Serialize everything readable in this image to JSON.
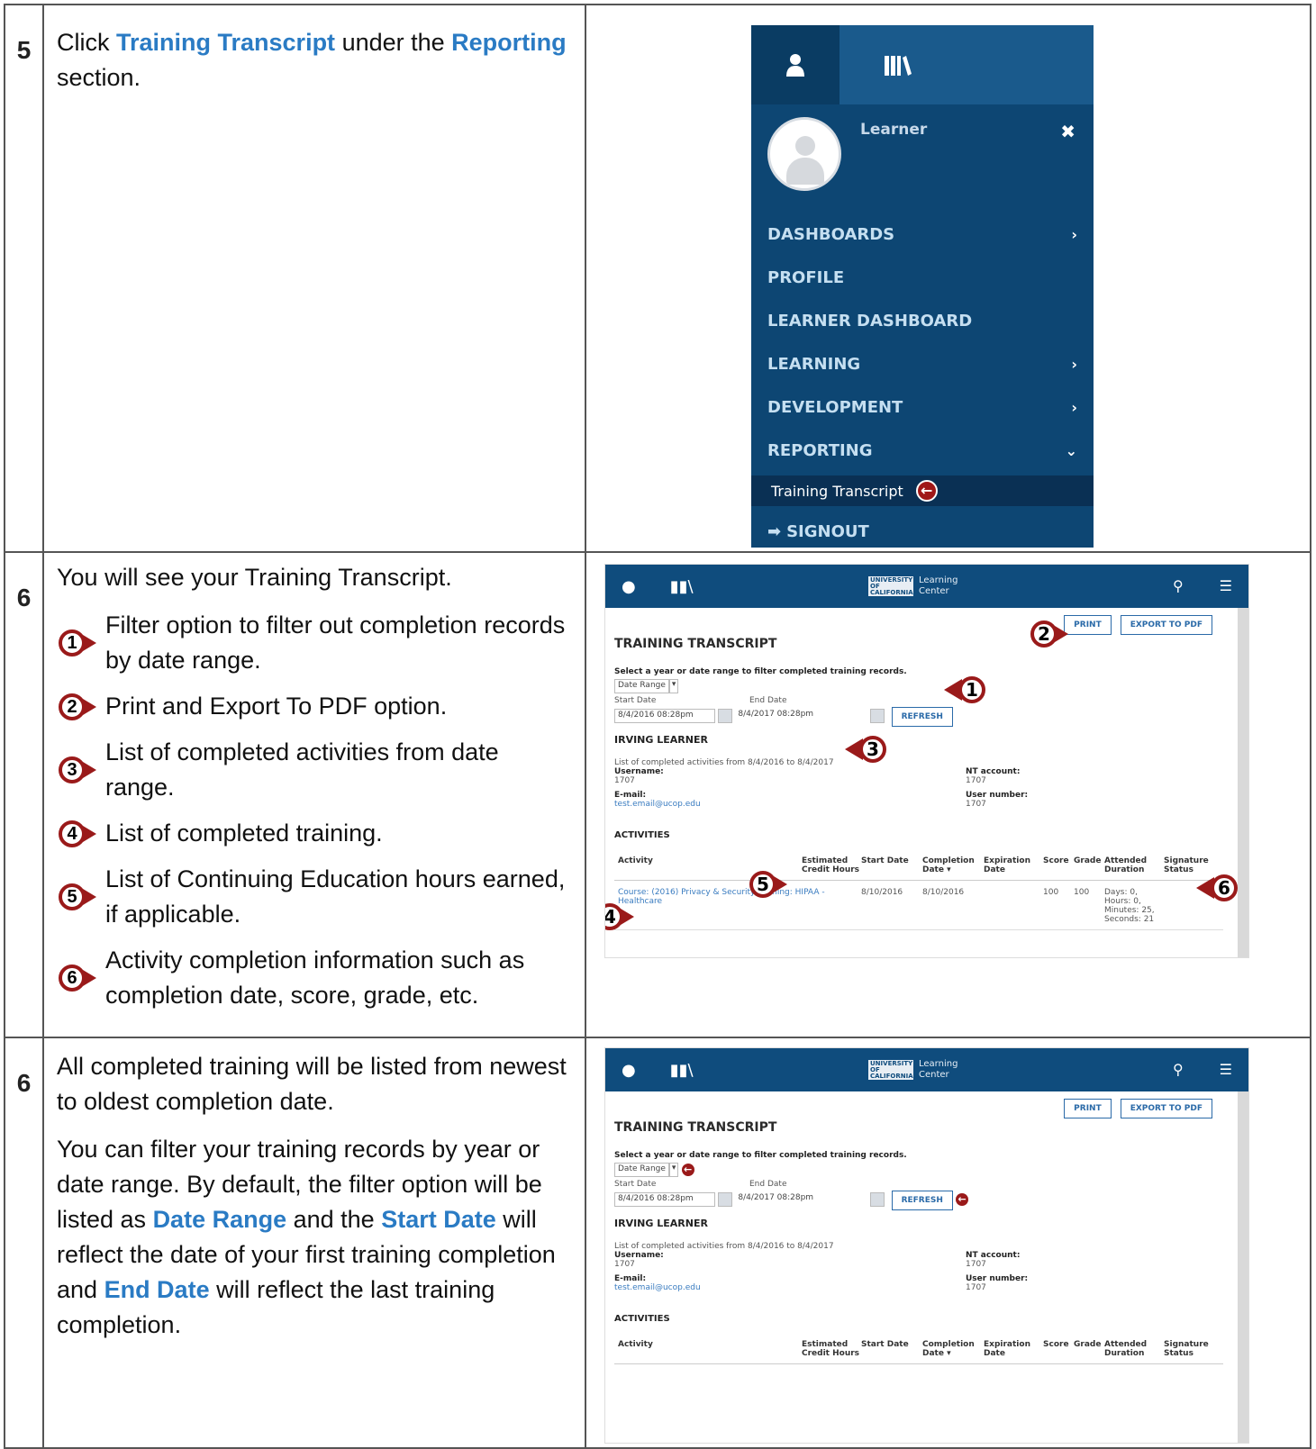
{
  "step5": {
    "number": "5",
    "text_pre": "Click ",
    "link1": "Training Transcript",
    "text_mid": " under the ",
    "link2": "Reporting",
    "text_post": " section.",
    "menu": {
      "learner_label": "Learner",
      "items": [
        {
          "label": "DASHBOARDS",
          "chevron": "›"
        },
        {
          "label": "PROFILE",
          "chevron": ""
        },
        {
          "label": "LEARNER DASHBOARD",
          "chevron": ""
        },
        {
          "label": "LEARNING",
          "chevron": "›"
        },
        {
          "label": "DEVELOPMENT",
          "chevron": "›"
        },
        {
          "label": "REPORTING",
          "chevron": "⌄"
        }
      ],
      "sub_item": "Training Transcript",
      "signout": "SIGNOUT"
    }
  },
  "step6a": {
    "number": "6",
    "intro": "You will see your Training Transcript.",
    "callouts": [
      {
        "n": "1",
        "text": "Filter option to filter out completion records by date range."
      },
      {
        "n": "2",
        "text": "Print and Export To PDF option."
      },
      {
        "n": "3",
        "text": "List of completed activities from date range."
      },
      {
        "n": "4",
        "text": "List of completed training."
      },
      {
        "n": "5",
        "text": "List of Continuing Education hours earned, if applicable."
      },
      {
        "n": "6",
        "text": "Activity completion information such as completion date, score, grade, etc."
      }
    ]
  },
  "step6b": {
    "number": "6",
    "p1": "All completed training will be listed from newest to oldest completion date.",
    "p2_a": "You can filter your training records by year or date range. By default, the filter option will be listed as ",
    "p2_b": "Date Range",
    "p2_c": " and the ",
    "p2_d": "Start Date",
    "p2_e": " will reflect the date of your first training completion and ",
    "p2_f": "End Date",
    "p2_g": " will reflect the last training completion."
  },
  "transcript": {
    "logo_uc": "UNIVERSITY OF CALIFORNIA",
    "logo_lc1": "Learning",
    "logo_lc2": "Center",
    "print": "PRINT",
    "export": "EXPORT TO PDF",
    "title": "TRAINING TRANSCRIPT",
    "filter_label": "Select a year or date range to filter completed training records.",
    "filter_value": "Date Range",
    "start_label": "Start Date",
    "end_label": "End Date",
    "start_value": "8/4/2016 08:28pm",
    "end_value": "8/4/2017 08:28pm",
    "refresh": "REFRESH",
    "name": "IRVING LEARNER",
    "range_text": "List of completed activities from  8/4/2016  to  8/4/2017",
    "username_label": "Username:",
    "username_value": "1707",
    "nt_label": "NT account:",
    "nt_value": "1707",
    "email_label": "E-mail:",
    "email_value": "test.email@ucop.edu",
    "usernum_label": "User number:",
    "usernum_value": "1707",
    "activities_title": "ACTIVITIES",
    "columns": [
      "Activity",
      "Estimated Credit Hours",
      "Start Date",
      "Completion Date ▾",
      "Expiration Date",
      "Score",
      "Grade",
      "Attended Duration",
      "Signature Status"
    ],
    "row": {
      "activity": "Course: (2016) Privacy & Security Training: HIPAA - Healthcare",
      "start": "8/10/2016",
      "completion": "8/10/2016",
      "score": "100",
      "grade": "100",
      "duration": "Days: 0, Hours: 0, Minutes: 25, Seconds: 21"
    }
  }
}
